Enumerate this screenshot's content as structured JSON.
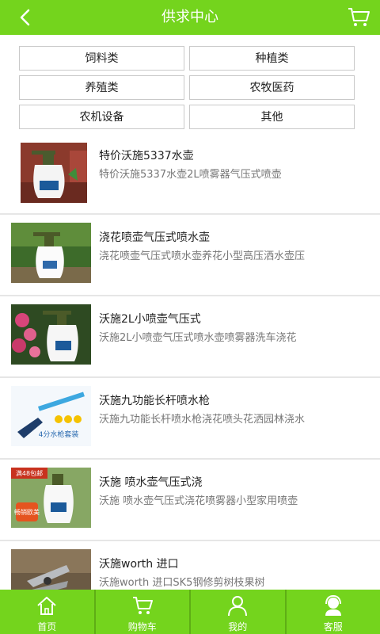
{
  "header": {
    "title": "供求中心",
    "back_icon": "chevron-left-icon",
    "cart_icon": "cart-icon"
  },
  "categories": [
    "饲料类",
    "种植类",
    "养殖类",
    "农牧医药",
    "农机设备",
    "其他"
  ],
  "products": [
    {
      "name": "特价沃施5337水壶",
      "desc": "特价沃施5337水壶2L喷雾器气压式喷壶"
    },
    {
      "name": "浇花喷壶气压式喷水壶",
      "desc": "浇花喷壶气压式喷水壶养花小型高压洒水壶压"
    },
    {
      "name": "沃施2L小喷壶气压式",
      "desc": "沃施2L小喷壶气压式喷水壶喷雾器洗车浇花"
    },
    {
      "name": "沃施九功能长杆喷水枪",
      "desc": "沃施九功能长杆喷水枪浇花喷头花洒园林浇水"
    },
    {
      "name": "沃施 喷水壶气压式浇",
      "desc": "沃施 喷水壶气压式浇花喷雾器小型家用喷壶"
    },
    {
      "name": "沃施worth 进口",
      "desc": "沃施worth 进口SK5钢修剪树枝果树"
    }
  ],
  "thumb_overlays": {
    "p4": "4分水枪套装",
    "p5a": "满48包邮",
    "p5b": "畅销欧美"
  },
  "bottom_tabs": [
    {
      "label": "首页",
      "icon": "home-icon"
    },
    {
      "label": "购物车",
      "icon": "cart-icon"
    },
    {
      "label": "我的",
      "icon": "user-icon"
    },
    {
      "label": "客服",
      "icon": "support-icon"
    }
  ],
  "colors": {
    "accent": "#74d41d"
  }
}
